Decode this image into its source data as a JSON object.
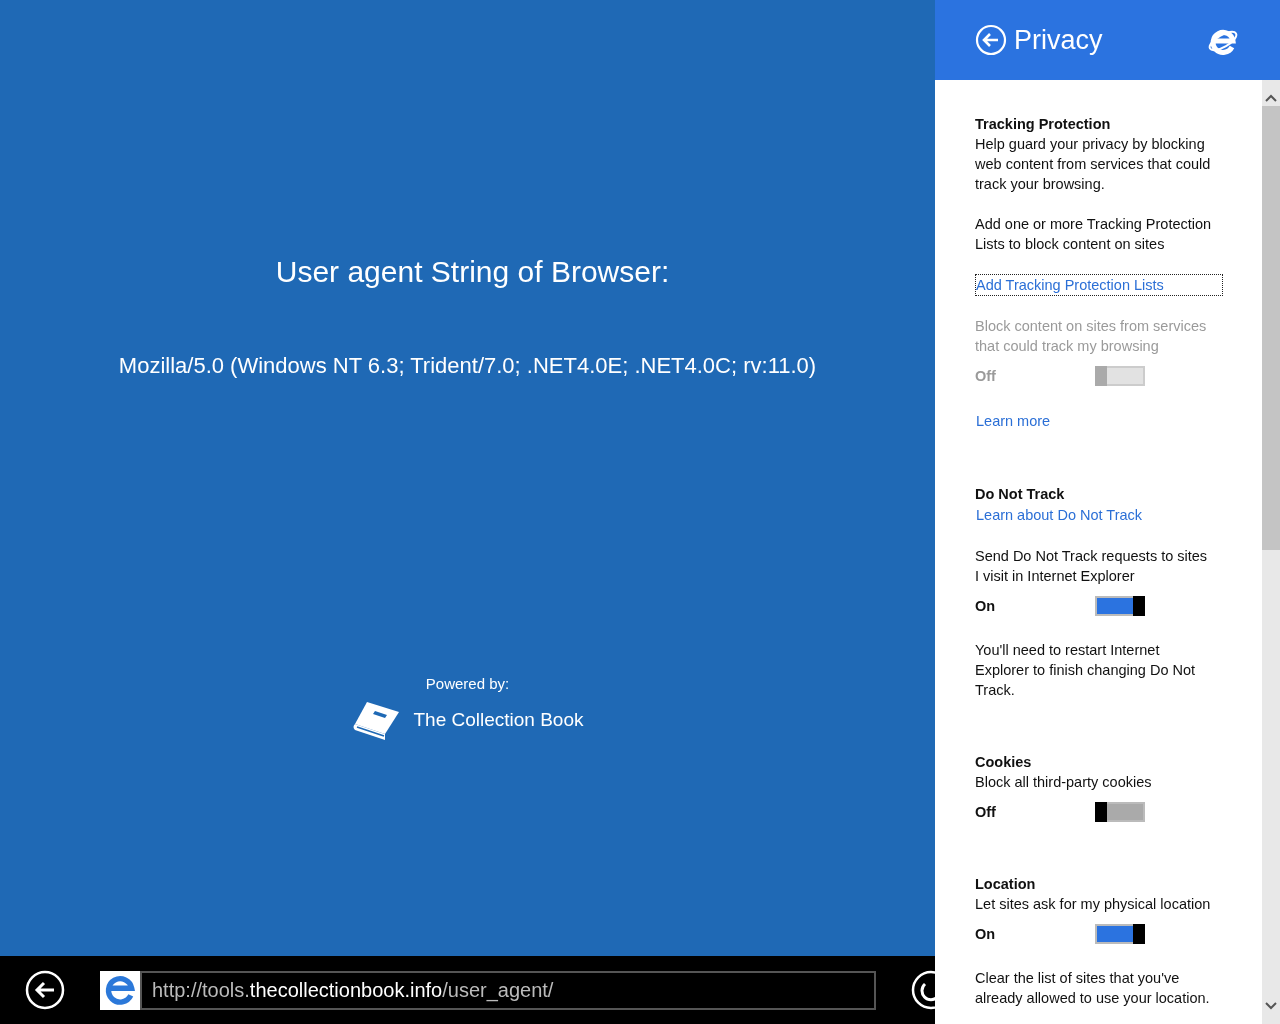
{
  "page": {
    "title": "User agent String of Browser:",
    "user_agent": "Mozilla/5.0 (Windows NT 6.3; Trident/7.0; .NET4.0E; .NET4.0C; rv:11.0)",
    "powered_by": "Powered by:",
    "brand": "The Collection Book"
  },
  "address_bar": {
    "url_prefix": "http://tools.",
    "url_domain": "thecollectionbook.info",
    "url_suffix": "/user_agent/"
  },
  "panel": {
    "title": "Privacy",
    "sections": [
      {
        "items": [
          {
            "kind": "heading",
            "text": "Tracking Protection"
          },
          {
            "kind": "text",
            "text": "Help guard your privacy by blocking web content from services that could track your browsing.",
            "disabled": false
          },
          {
            "kind": "text",
            "text": "Add one or more Tracking Protection Lists to block content on sites",
            "disabled": false
          },
          {
            "kind": "link",
            "text": "Add Tracking Protection Lists",
            "focused": true
          },
          {
            "kind": "text",
            "text": "Block content on sites from services that could track my browsing",
            "disabled": true
          },
          {
            "kind": "toggle",
            "text": "Off",
            "on": false,
            "disabled": true
          },
          {
            "kind": "link",
            "text": "Learn more",
            "focused": false
          }
        ]
      },
      {
        "items": [
          {
            "kind": "heading",
            "text": "Do Not Track"
          },
          {
            "kind": "link",
            "text": "Learn about Do Not Track",
            "focused": false
          },
          {
            "kind": "text",
            "text": "Send Do Not Track requests to sites I visit in Internet Explorer",
            "disabled": false
          },
          {
            "kind": "toggle",
            "text": "On",
            "on": true,
            "disabled": false
          },
          {
            "kind": "text",
            "text": "You'll need to restart Internet Explorer to finish changing Do Not Track.",
            "disabled": false
          }
        ]
      },
      {
        "items": [
          {
            "kind": "heading",
            "text": "Cookies"
          },
          {
            "kind": "text",
            "text": "Block all third-party cookies",
            "disabled": false
          },
          {
            "kind": "toggle",
            "text": "Off",
            "on": false,
            "disabled": false
          }
        ]
      },
      {
        "items": [
          {
            "kind": "heading",
            "text": "Location"
          },
          {
            "kind": "text",
            "text": "Let sites ask for my physical location",
            "disabled": false
          },
          {
            "kind": "toggle",
            "text": "On",
            "on": true,
            "disabled": false
          },
          {
            "kind": "text",
            "text": "Clear the list of sites that you've already allowed to use your location.",
            "disabled": false
          }
        ]
      }
    ]
  }
}
